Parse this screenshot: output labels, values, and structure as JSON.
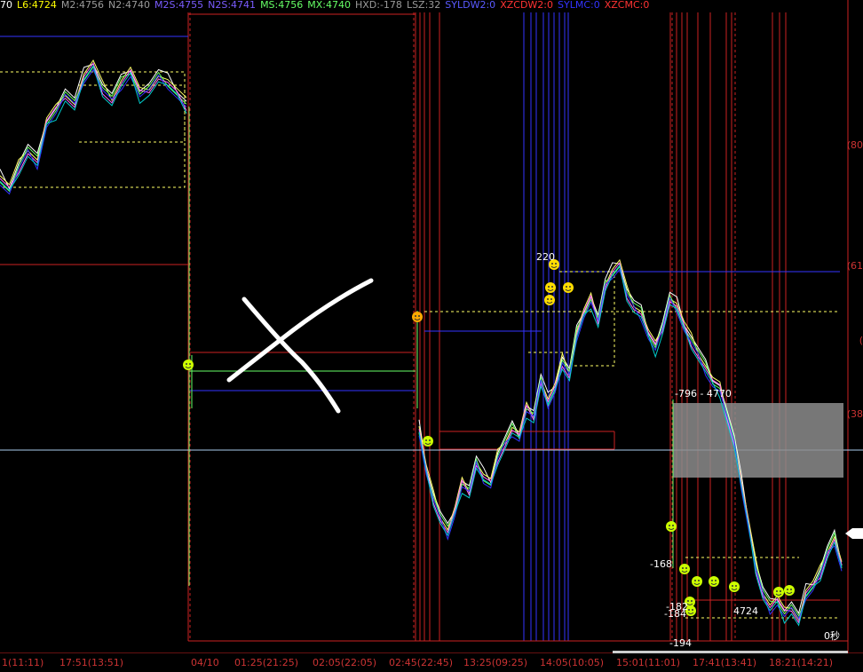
{
  "header": {
    "items": [
      {
        "text": "70",
        "color": "#ffffff"
      },
      {
        "text": "L6:4724",
        "color": "#ffff00"
      },
      {
        "text": "M2:4756",
        "color": "#9a9a9a"
      },
      {
        "text": "N2:4740",
        "color": "#9a9a9a"
      },
      {
        "text": "M2S:4755",
        "color": "#7a5cff"
      },
      {
        "text": "N2S:4741",
        "color": "#7a5cff"
      },
      {
        "text": "MS:4756",
        "color": "#66ff66"
      },
      {
        "text": "MX:4740",
        "color": "#66ff66"
      },
      {
        "text": "HXD:-178",
        "color": "#9a9a9a"
      },
      {
        "text": "LSZ:32",
        "color": "#9a9a9a"
      },
      {
        "text": "SYLDW2:0",
        "color": "#5a5aff"
      },
      {
        "text": "XZCDW2:0",
        "color": "#ff3333"
      },
      {
        "text": "SYLMC:0",
        "color": "#3333ff"
      },
      {
        "text": "XZCMC:0",
        "color": "#ff3333"
      }
    ]
  },
  "x_ticks": [
    "1(11:11)",
    "17:51(13:51)",
    "04/10",
    "01:25(21:25)",
    "02:05(22:05)",
    "02:45(22:45)",
    "13:25(09:25)",
    "14:05(10:05)",
    "15:01(11:01)",
    "17:41(13:41)",
    "18:21(14:21)"
  ],
  "right_labels": [
    "(80",
    "(61",
    "(",
    "(38"
  ],
  "annotations": {
    "peak": "220",
    "range": "-796 - 4770",
    "a168": "-168",
    "a182": "-182",
    "a184": "-184",
    "a4724": "4724",
    "a194": "-194"
  },
  "status_text": "0秒",
  "colors": {
    "background": "#000000",
    "axis_red": "#cc2222",
    "price_lines": [
      "#ffffff",
      "#ffff66",
      "#66ff66",
      "#ff66ff",
      "#3333ff",
      "#00cccc"
    ],
    "highlight_box": "#8c8c8c",
    "smiley_green": "#ccff00",
    "smiley_orange": "#ffaa00"
  },
  "chart_data": {
    "type": "line",
    "title": "",
    "xlabel": "",
    "ylabel": "",
    "segments": [
      {
        "name": "",
        "x": [
          0,
          1,
          2,
          3,
          4,
          5,
          6,
          7,
          8,
          9,
          10,
          11,
          12,
          13,
          14,
          15,
          16,
          17,
          18,
          19,
          20
        ],
        "y": [
          50,
          48,
          52,
          55,
          53,
          60,
          62,
          65,
          63,
          68,
          70,
          66,
          64,
          67,
          69,
          65,
          66,
          68,
          67,
          65,
          63
        ]
      },
      {
        "name": "",
        "x": [
          0,
          1,
          2,
          3,
          4,
          5,
          6,
          7,
          8,
          9,
          10,
          11,
          12,
          13,
          14,
          15,
          16,
          17,
          18,
          19,
          20,
          21,
          22,
          23,
          24,
          25,
          26,
          27,
          28,
          29,
          30,
          31,
          32,
          33,
          34,
          35,
          36,
          37,
          38,
          39,
          40,
          41,
          42,
          43,
          44,
          45,
          46,
          47,
          48,
          49,
          50,
          51,
          52,
          53,
          54,
          55,
          56,
          57,
          58,
          59
        ],
        "y": [
          38,
          32,
          28,
          25,
          23,
          26,
          30,
          29,
          33,
          31,
          30,
          34,
          36,
          38,
          37,
          41,
          40,
          45,
          42,
          44,
          48,
          46,
          52,
          55,
          57,
          54,
          59,
          61,
          62,
          58,
          56,
          55,
          52,
          50,
          53,
          57,
          56,
          53,
          51,
          49,
          47,
          45,
          44,
          40,
          36,
          30,
          24,
          18,
          14,
          12,
          13,
          11,
          12,
          10,
          14,
          15,
          17,
          20,
          22,
          18
        ]
      }
    ],
    "horizontal_levels": [
      {
        "label": "blue",
        "value": 82
      },
      {
        "label": "red",
        "value": 62
      },
      {
        "label": "cyan",
        "value": 34
      }
    ]
  }
}
